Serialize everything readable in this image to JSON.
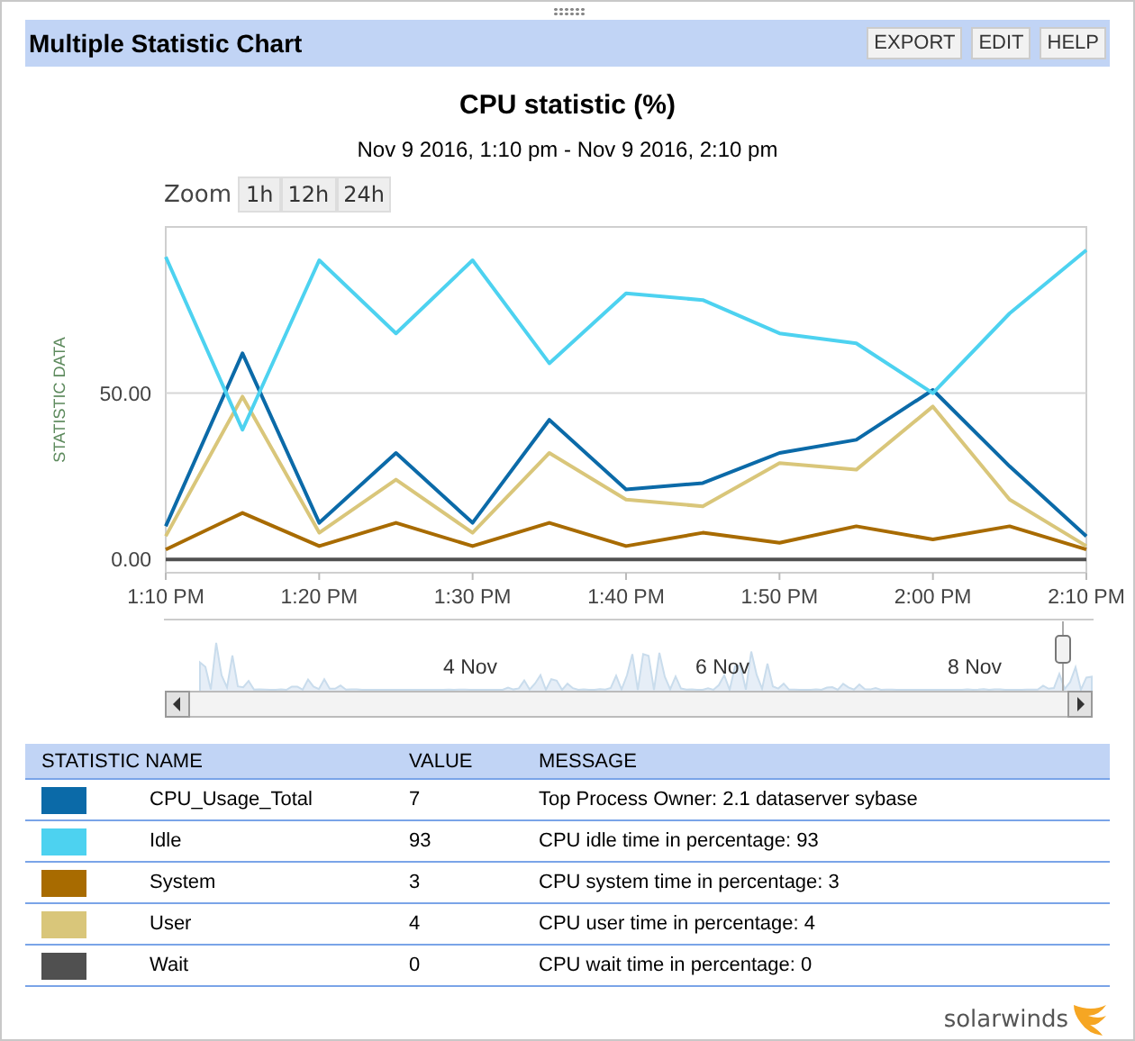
{
  "panel": {
    "title": "Multiple Statistic Chart",
    "buttons": [
      "EXPORT",
      "EDIT",
      "HELP"
    ]
  },
  "chart": {
    "subtitle": "Nov 9 2016, 1:10 pm - Nov 9 2016, 2:10 pm",
    "zoom_label": "Zoom",
    "zoom_buttons": [
      "1h",
      "12h",
      "24h"
    ],
    "chart_data": {
      "type": "line",
      "title": "CPU statistic (%)",
      "ylabel": "STATISTIC DATA",
      "categories": [
        "1:10 PM",
        null,
        "1:20 PM",
        null,
        "1:30 PM",
        null,
        "1:40 PM",
        null,
        "1:50 PM",
        null,
        "2:00 PM",
        null,
        "2:10 PM"
      ],
      "ylim": [
        -4,
        100
      ],
      "yticks": [
        {
          "value": 0,
          "label": "0.00"
        },
        {
          "value": 50,
          "label": "50.00"
        }
      ],
      "series": [
        {
          "color": "#505050",
          "values": [
            0,
            0,
            0,
            0,
            0,
            0,
            0,
            0,
            0,
            0,
            0,
            0,
            0
          ]
        },
        {
          "color": "#a86b00",
          "values": [
            3,
            14,
            4,
            11,
            4,
            11,
            4,
            8,
            5,
            10,
            6,
            10,
            3
          ]
        },
        {
          "color": "#d9c67a",
          "values": [
            7,
            49,
            8,
            24,
            8,
            32,
            18,
            16,
            29,
            27,
            46,
            18,
            4
          ]
        },
        {
          "color": "#0b6aa8",
          "values": [
            10,
            62,
            11,
            32,
            11,
            42,
            21,
            23,
            32,
            36,
            51,
            28,
            7
          ]
        },
        {
          "color": "#4dd2f0",
          "values": [
            91,
            39,
            90,
            68,
            90,
            59,
            80,
            78,
            68,
            65,
            50,
            74,
            93
          ]
        }
      ]
    },
    "navigator": {
      "labels": [
        "4 Nov",
        "6 Nov",
        "8 Nov"
      ]
    }
  },
  "table": {
    "columns": [
      "STATISTIC NAME",
      "VALUE",
      "MESSAGE"
    ],
    "rows": [
      {
        "color": "#0b6aa8",
        "name": "CPU_Usage_Total",
        "value": "7",
        "message": "Top Process Owner: 2.1 dataserver sybase"
      },
      {
        "color": "#4dd2f0",
        "name": "Idle",
        "value": "93",
        "message": "CPU idle time in percentage: 93"
      },
      {
        "color": "#a86b00",
        "name": "System",
        "value": "3",
        "message": "CPU system time in percentage: 3"
      },
      {
        "color": "#d9c67a",
        "name": "User",
        "value": "4",
        "message": "CPU user time in percentage: 4"
      },
      {
        "color": "#505050",
        "name": "Wait",
        "value": "0",
        "message": "CPU wait time in percentage: 0"
      }
    ]
  },
  "footer": {
    "logo": "solarwinds"
  }
}
